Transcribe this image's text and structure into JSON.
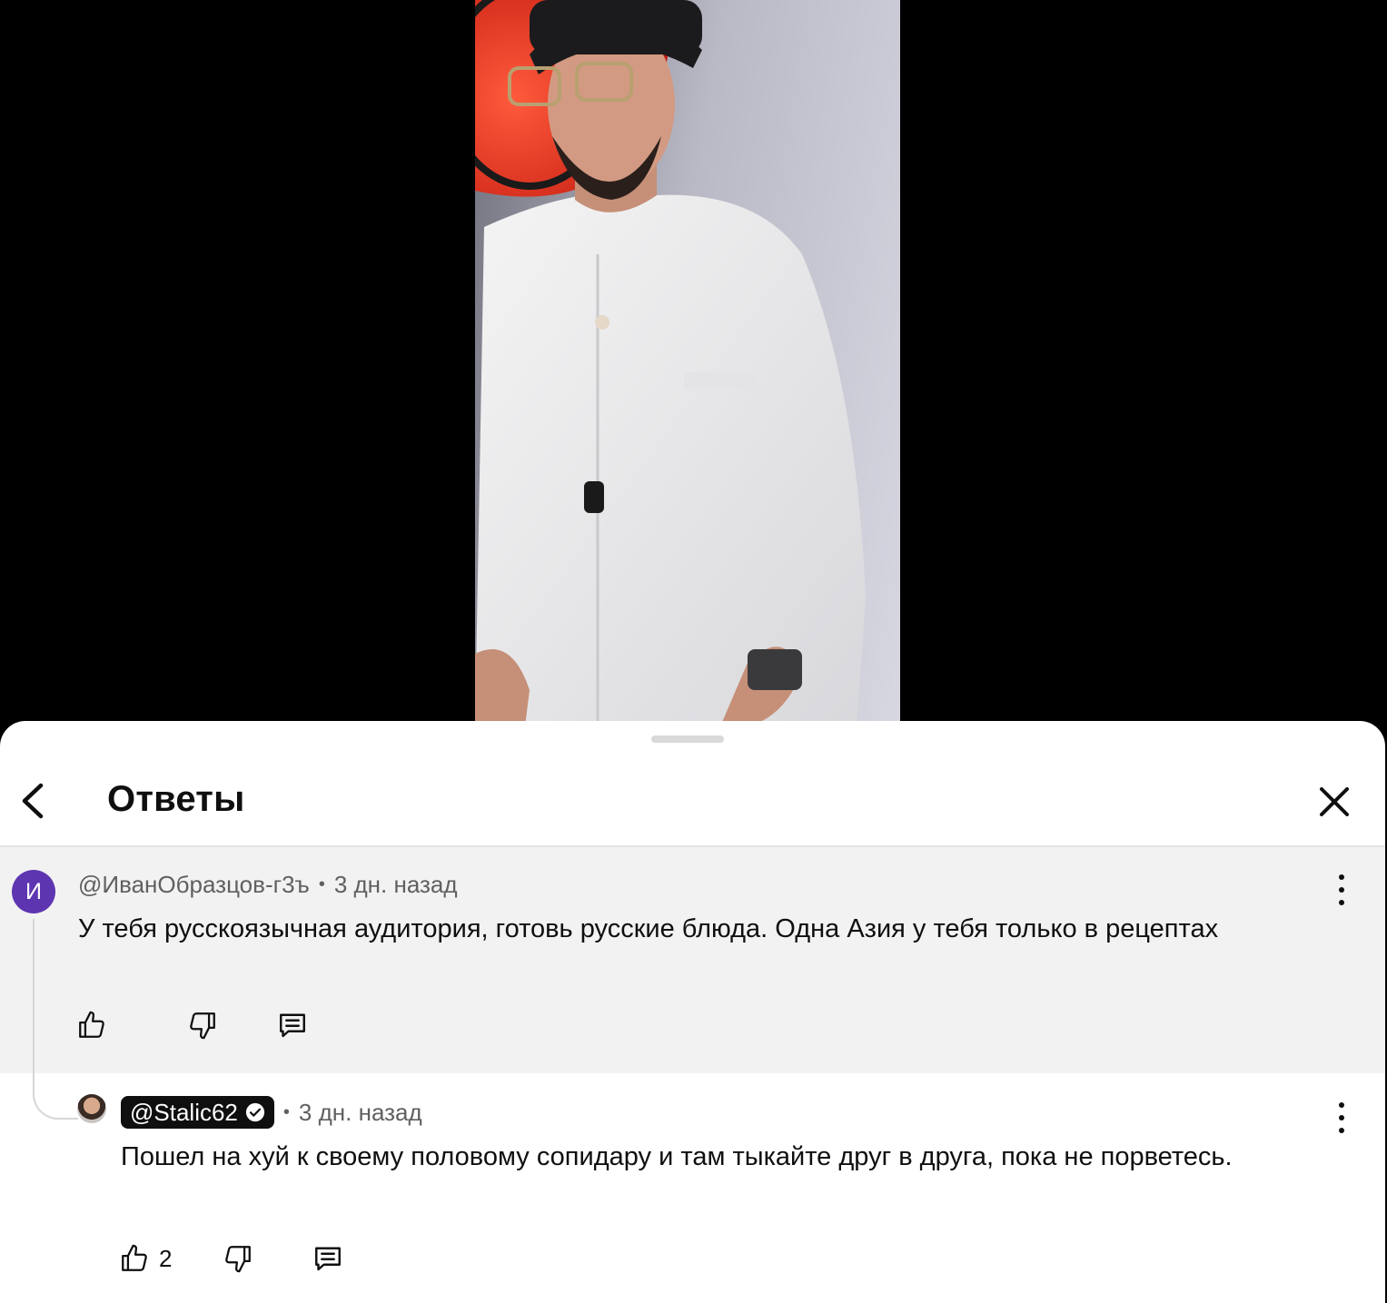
{
  "sheet": {
    "title": "Ответы"
  },
  "parent_comment": {
    "avatar_letter": "И",
    "author": "@ИванОбразцов-г3ъ",
    "separator": "•",
    "time": "3 дн. назад",
    "text": "У тебя русскоязычная аудитория, готовь русские блюда. Одна Азия у тебя только в рецептах",
    "likes": ""
  },
  "reply": {
    "author": "@Stalic62",
    "separator": "•",
    "time": "3 дн. назад",
    "text": "Пошел на хуй к своему половому сопидару и там тыкайте друг в друга, пока не порветесь.",
    "likes": "2"
  },
  "colors": {
    "avatar_bg": "#5e35b1",
    "parent_bg": "#f2f2f2",
    "chip_bg": "#0f0f0f"
  },
  "icons": [
    "back-arrow-icon",
    "close-icon",
    "like-icon",
    "dislike-icon",
    "reply-icon",
    "more-vertical-icon",
    "verified-icon"
  ]
}
